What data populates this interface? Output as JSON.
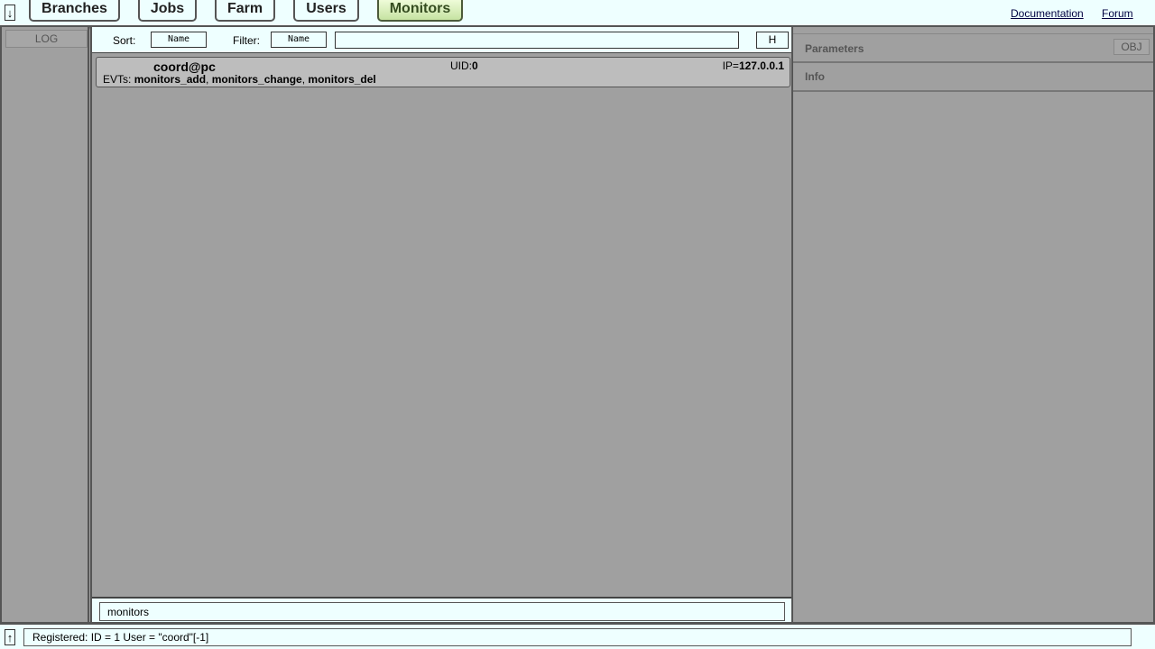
{
  "topbar": {
    "collapse_arrow": "↓",
    "tabs": [
      {
        "label": "Branches"
      },
      {
        "label": "Jobs"
      },
      {
        "label": "Farm"
      },
      {
        "label": "Users"
      },
      {
        "label": "Monitors",
        "active": true
      }
    ],
    "links": {
      "documentation": "Documentation",
      "forum": "Forum"
    }
  },
  "left_panel": {
    "log_label": "LOG"
  },
  "controls": {
    "sort_label": "Sort:",
    "sort_value": "Name",
    "filter_label": "Filter:",
    "filter_by_value": "Name",
    "filter_text": "",
    "h_label": "H"
  },
  "monitors": [
    {
      "name": "coord@pc",
      "uid_label": "UID:",
      "uid": "0",
      "ip_label": "IP=",
      "ip": "127.0.0.1",
      "evts_label": "EVTs:",
      "evts": [
        "monitors_add",
        "monitors_change",
        "monitors_del"
      ]
    }
  ],
  "command": {
    "value": "monitors"
  },
  "right_panel": {
    "parameters_label": "Parameters",
    "obj_label": "OBJ",
    "info_label": "Info"
  },
  "bottombar": {
    "expand_arrow": "↑",
    "status_text": "Registered: ID = 1 User = \"coord\"[-1]"
  },
  "colors": {
    "bar_background": "#eeffff",
    "panel_background": "#a0a0a0",
    "active_tab_text": "#354d20"
  }
}
